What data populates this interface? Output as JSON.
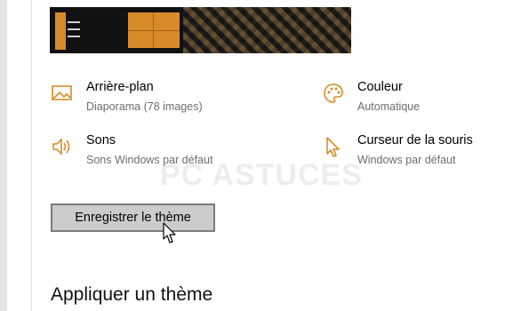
{
  "settings": {
    "background": {
      "title": "Arrière-plan",
      "value": "Diaporama (78 images)"
    },
    "color": {
      "title": "Couleur",
      "value": "Automatique"
    },
    "sounds": {
      "title": "Sons",
      "value": "Sons Windows par défaut"
    },
    "cursor": {
      "title": "Curseur de la souris",
      "value": "Windows par défaut"
    }
  },
  "save_button": "Enregistrer le thème",
  "section_title": "Appliquer un thème",
  "watermark": "PC ASTUCES",
  "colors": {
    "accent": "#d98b2a",
    "button_bg": "#cccccc",
    "button_border": "#7a7a7a"
  }
}
